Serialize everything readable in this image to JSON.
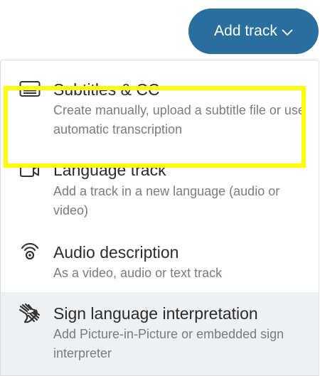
{
  "add_track_button": {
    "label": "Add track",
    "color": "#286fa0"
  },
  "menu": {
    "items": [
      {
        "title": "Subtitles & CC",
        "description": "Create manually, upload a subtitle file or use automatic transcription",
        "icon": "subtitles-icon"
      },
      {
        "title": "Language track",
        "description": "Add a track in a new language (audio or video)",
        "icon": "video-camera-icon",
        "highlighted": true
      },
      {
        "title": "Audio description",
        "description": "As a video, audio or text track",
        "icon": "audio-description-icon"
      },
      {
        "title": "Sign language interpretation",
        "description": "Add Picture-in-Picture or embedded sign interpreter",
        "icon": "sign-language-icon",
        "hovered": true
      }
    ]
  },
  "colors": {
    "highlight_border": "#ffff00",
    "hover_background": "#eef1f4"
  }
}
